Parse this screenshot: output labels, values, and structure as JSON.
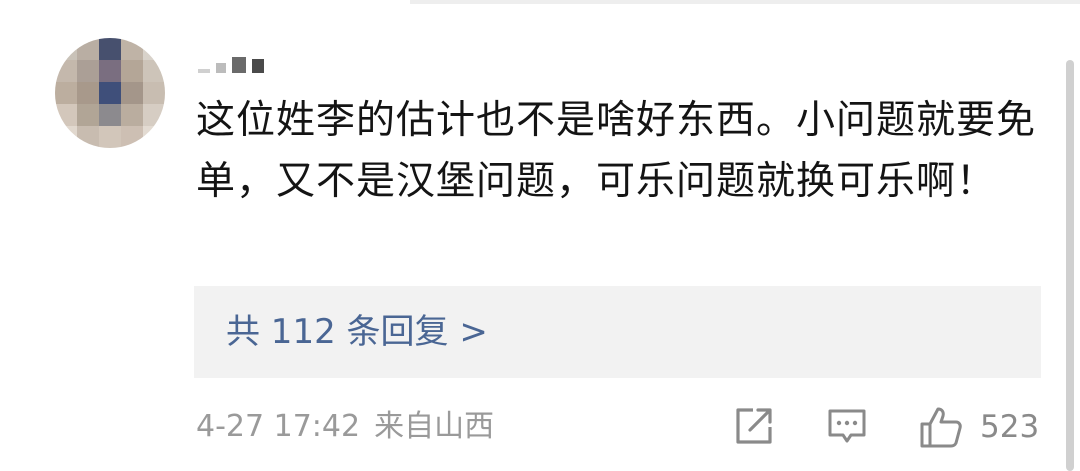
{
  "comment": {
    "text": "这位姓李的估计也不是啥好东西。小问题就要免单，又不是汉堡问题，可乐问题就换可乐啊！",
    "replies_label": "共 112 条回复 >",
    "timestamp": "4-27 17:42",
    "location": "来自山西",
    "like_count": "523"
  },
  "icons": {
    "share": "share-icon",
    "comment": "comment-icon",
    "like": "thumbs-up-icon"
  },
  "colors": {
    "text": "#141414",
    "link": "#4a6694",
    "meta": "#9a9a9a",
    "reply_bg": "#f2f2f2"
  }
}
